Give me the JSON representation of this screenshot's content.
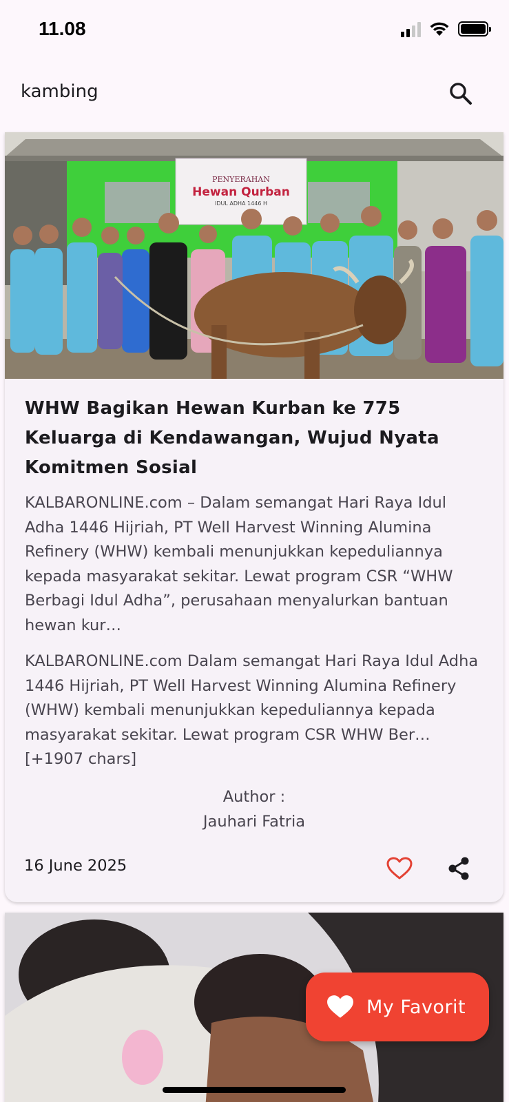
{
  "status_bar": {
    "time": "11.08"
  },
  "search": {
    "query": "kambing"
  },
  "articles": [
    {
      "title": "WHW Bagikan Hewan Kurban ke 775 Keluarga di Kendawangan, Wujud Nyata Komitmen Sosial",
      "description": "KALBARONLINE.com – Dalam semangat Hari Raya Idul Adha 1446 Hijriah, PT Well Harvest Winning Alumina Refinery (WHW) kembali menunjukkan kepeduliannya kepada masyarakat sekitar. Lewat program CSR “WHW Berbagi Idul Adha”, perusahaan menyalurkan bantuan hewan kur…",
      "content": "KALBARONLINE.com Dalam semangat Hari Raya Idul Adha 1446 Hijriah, PT Well Harvest Winning Alumina Refinery (WHW) kembali menunjukkan kepeduliannya kepada masyarakat sekitar. Lewat program CSR WHW Ber… [+1907 chars]",
      "author_label": "Author :",
      "author": "Jauhari Fatria",
      "date": "16 June 2025",
      "image_banner": {
        "line1": "PENYERAHAN",
        "line2": "Hewan Qurban",
        "line3": "IDUL ADHA 1446 H"
      }
    }
  ],
  "fab": {
    "label": "My Favorit"
  },
  "icons": {
    "search": "search-icon",
    "favorite": "heart-outline-icon",
    "share": "share-icon",
    "fab": "heart-filled-icon"
  },
  "colors": {
    "background": "#fdf7fc",
    "card": "#f7f2f8",
    "accent": "#f04332"
  }
}
